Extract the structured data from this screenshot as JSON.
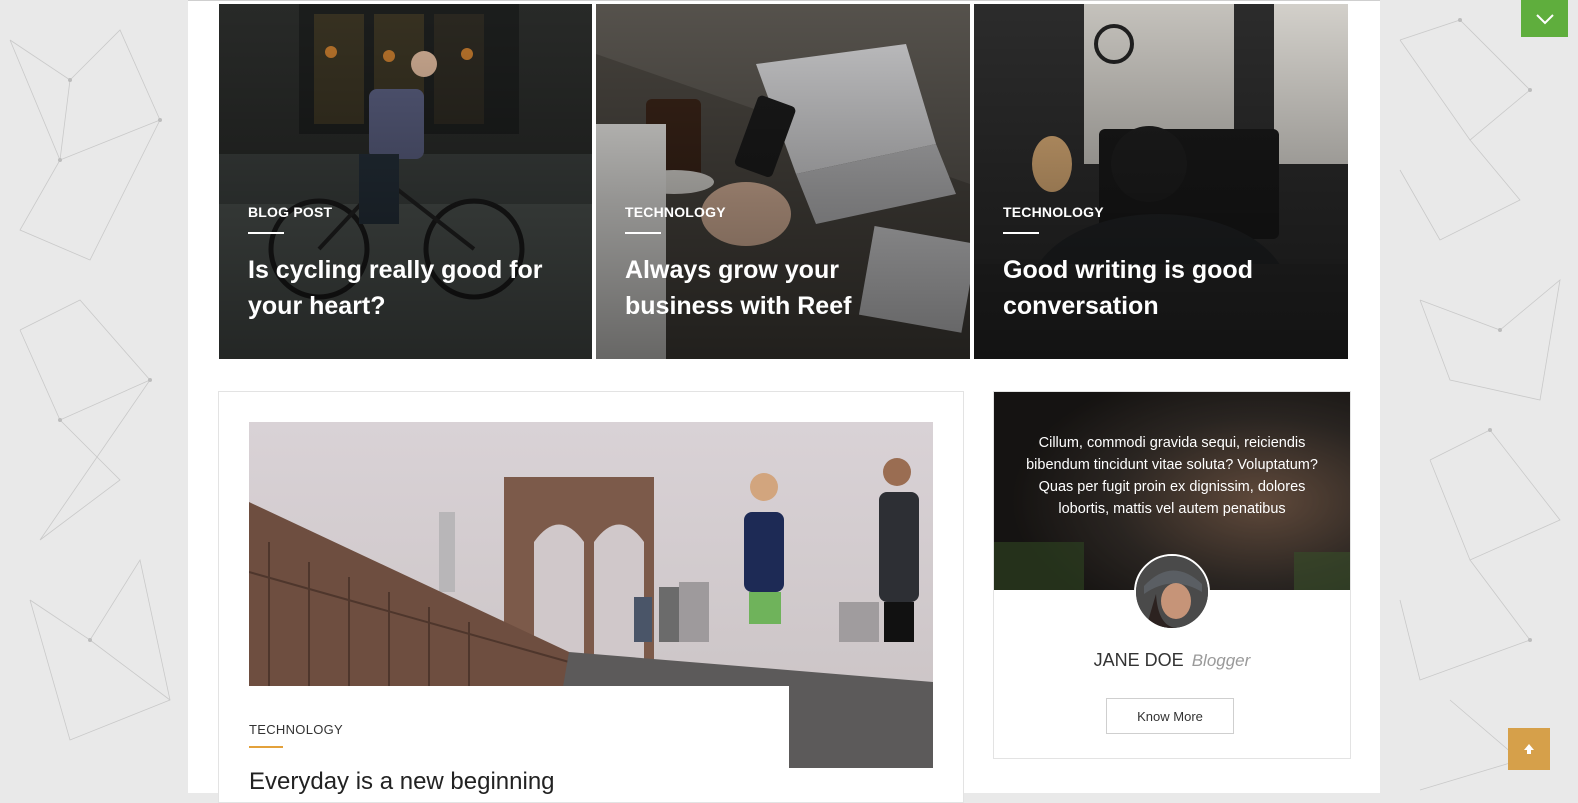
{
  "featured": [
    {
      "category": "BLOG POST",
      "title": "Is cycling really good for your heart?"
    },
    {
      "category": "TECHNOLOGY",
      "title": "Always grow your business with Reef"
    },
    {
      "category": "TECHNOLOGY",
      "title": "Good writing is good conversation"
    }
  ],
  "post": {
    "category": "TECHNOLOGY",
    "title": "Everyday is a new beginning"
  },
  "author": {
    "quote": "Cillum, commodi gravida sequi, reiciendis bibendum tincidunt vitae soluta? Voluptatum? Quas per fugit proin ex dignissim, dolores lobortis, mattis vel autem penatibus",
    "name": "JANE DOE",
    "role": "Blogger",
    "button_label": "Know More"
  },
  "icons": {
    "toggle": "chevron-down-icon",
    "back_to_top": "arrow-up-icon"
  },
  "colors": {
    "accent_green": "#5fae3d",
    "accent_gold": "#d6a04a",
    "category_underline": "#e3a13b"
  }
}
